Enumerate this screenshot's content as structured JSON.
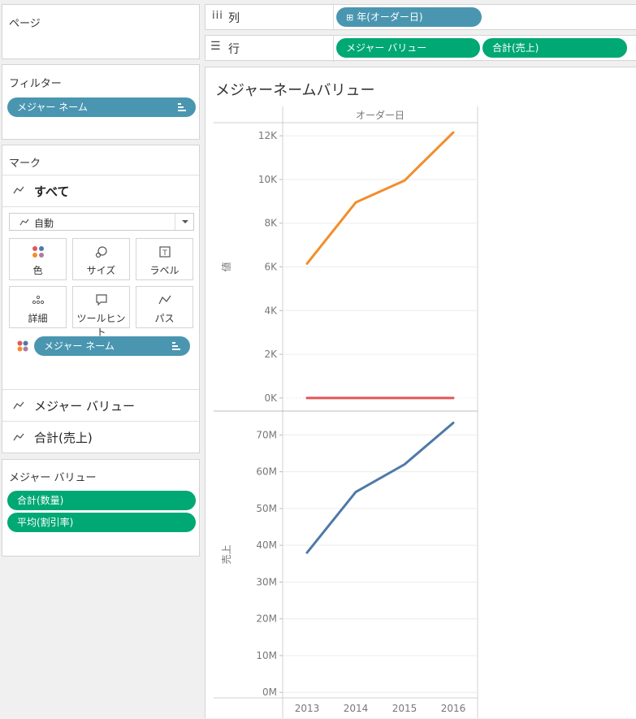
{
  "pages_panel": {
    "title": "ページ"
  },
  "filters_panel": {
    "title": "フィルター",
    "pill": "メジャー ネーム"
  },
  "marks_panel": {
    "title": "マーク",
    "all_label": "すべて",
    "mark_type": "自動",
    "buttons": {
      "color": "色",
      "size": "サイズ",
      "label": "ラベル",
      "detail": "詳細",
      "tooltip": "ツールヒント",
      "path": "パス"
    },
    "color_pill": "メジャー ネーム",
    "measure_values_label": "メジャー バリュー",
    "sum_sales_label": "合計(売上)"
  },
  "measure_values_panel": {
    "title": "メジャー バリュー",
    "pills": [
      "合計(数量)",
      "平均(割引率)"
    ]
  },
  "shelves": {
    "columns_label": "列",
    "columns_pill": "年(オーダー日)",
    "rows_label": "行",
    "rows_pills": [
      "メジャー バリュー",
      "合計(売上)"
    ]
  },
  "view": {
    "title": "メジャーネームバリュー",
    "header": "オーダー日"
  },
  "chart_data": [
    {
      "type": "line",
      "ylabel": "値",
      "x": [
        "2013",
        "2014",
        "2015",
        "2016"
      ],
      "yticks": [
        "0K",
        "2K",
        "4K",
        "6K",
        "8K",
        "10K",
        "12K"
      ],
      "ylim": [
        -600,
        12600
      ],
      "series": [
        {
          "values": [
            6150,
            8950,
            9950,
            12150
          ],
          "color": "#f28e2b"
        },
        {
          "values": [
            0.16,
            0.16,
            0.16,
            0.16
          ],
          "color": "#e15759"
        }
      ],
      "grid": true
    },
    {
      "type": "line",
      "ylabel": "売上",
      "x": [
        "2013",
        "2014",
        "2015",
        "2016"
      ],
      "yticks": [
        "0M",
        "10M",
        "20M",
        "30M",
        "40M",
        "50M",
        "60M",
        "70M"
      ],
      "ylim": [
        -1500000,
        76500000
      ],
      "series": [
        {
          "values": [
            38000000,
            54500000,
            62000000,
            73300000
          ],
          "color": "#4e79a7"
        }
      ],
      "grid": true
    }
  ]
}
